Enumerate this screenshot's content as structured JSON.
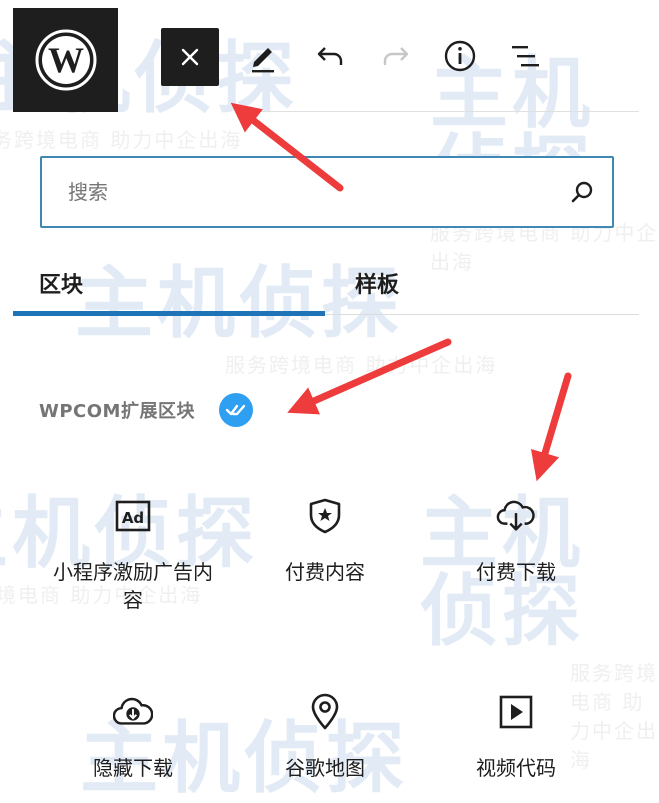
{
  "watermark": {
    "glyphs": "主机侦探",
    "tagline": "服务跨境电商 助力中企出海"
  },
  "toolbar": {
    "logo_text": "W",
    "close_symbol": "×"
  },
  "search": {
    "placeholder": "搜索",
    "value": ""
  },
  "tabs": [
    {
      "label": "区块",
      "active": true
    },
    {
      "label": "样板",
      "active": false
    }
  ],
  "category": {
    "label": "WPCOM扩展区块"
  },
  "blocks": [
    {
      "label": "小程序激励广告内容",
      "icon": "ad-icon"
    },
    {
      "label": "付费内容",
      "icon": "shield-star-icon"
    },
    {
      "label": "付费下载",
      "icon": "cloud-download-icon"
    },
    {
      "label": "隐藏下载",
      "icon": "cloud-download-filled-icon"
    },
    {
      "label": "谷歌地图",
      "icon": "map-pin-icon"
    },
    {
      "label": "视频代码",
      "icon": "video-play-icon"
    }
  ],
  "colors": {
    "accent": "#1e74b6",
    "search_border": "#3f87b5",
    "badge": "#2f9ff2",
    "annotation": "#ee3b3b",
    "dark": "#1e1e1e"
  }
}
